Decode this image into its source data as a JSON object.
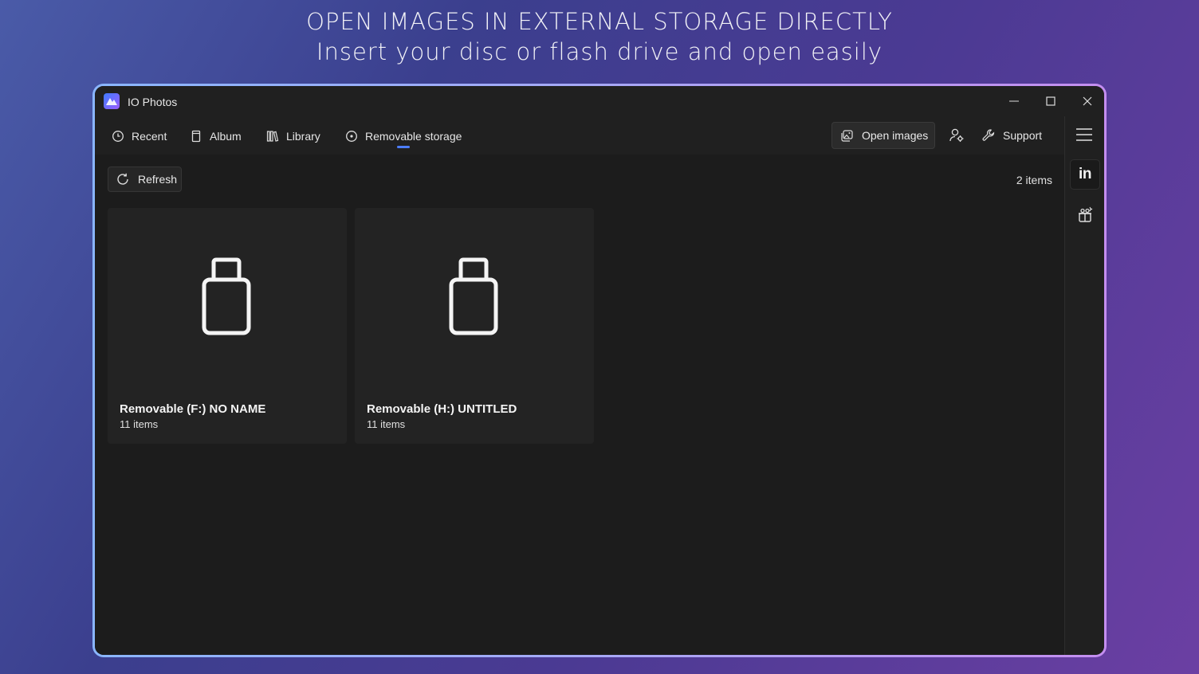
{
  "banner": {
    "line1": "OPEN IMAGES IN EXTERNAL STORAGE DIRECTLY",
    "line2": "Insert your disc or flash drive and open easily"
  },
  "window": {
    "title": "IO Photos"
  },
  "nav": {
    "items": [
      {
        "label": "Recent",
        "icon": "clock-icon"
      },
      {
        "label": "Album",
        "icon": "album-icon"
      },
      {
        "label": "Library",
        "icon": "library-icon"
      },
      {
        "label": "Removable storage",
        "icon": "disc-icon",
        "selected": true
      }
    ],
    "open_images": "Open images",
    "support": "Support"
  },
  "toolbar": {
    "refresh": "Refresh",
    "item_count": "2 items"
  },
  "drives": [
    {
      "name": "Removable (F:) NO NAME",
      "count": "11 items",
      "icon": "usb-drive-icon"
    },
    {
      "name": "Removable (H:) UNTITLED",
      "count": "11 items",
      "icon": "usb-drive-icon"
    }
  ],
  "side": {
    "linkedin": "in"
  },
  "colors": {
    "accent": "#4c7dff",
    "window_bg": "#1c1c1c",
    "border_gradient_start": "#8ab6ff",
    "border_gradient_end": "#c48ef0"
  }
}
